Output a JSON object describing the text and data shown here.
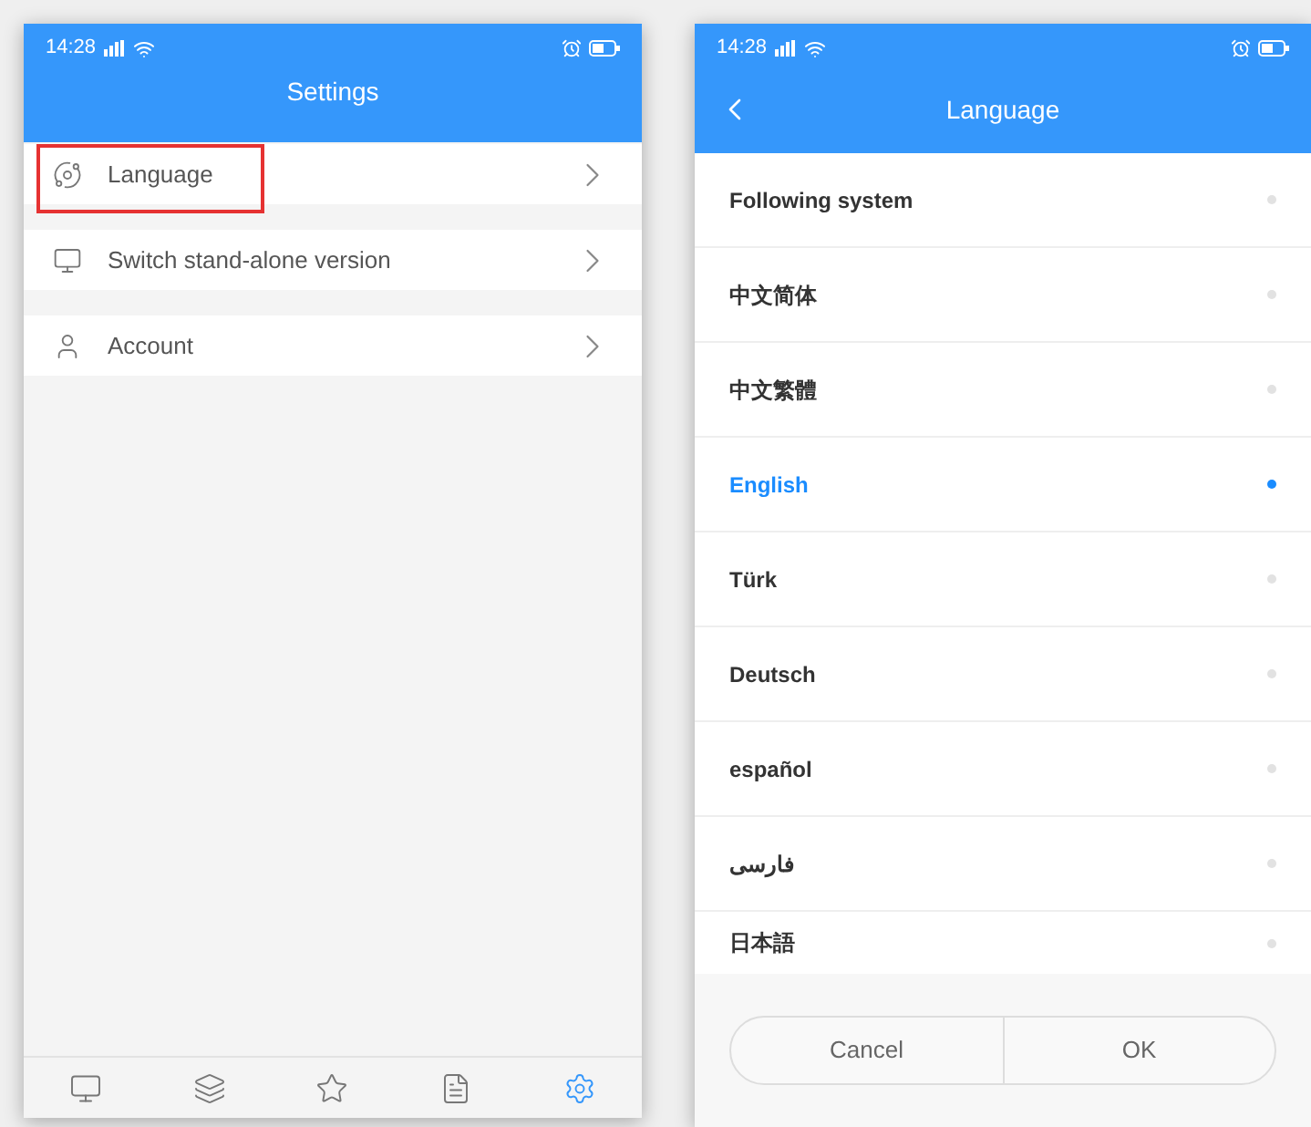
{
  "settings_screen": {
    "status_bar": {
      "time": "14:28"
    },
    "title": "Settings",
    "items": [
      {
        "label": "Language",
        "kind": "planet",
        "highlighted": true
      },
      {
        "label": "Switch stand-alone version",
        "kind": "monitor",
        "highlighted": false
      },
      {
        "label": "Account",
        "kind": "person",
        "highlighted": false
      }
    ],
    "nav_tabs": [
      {
        "kind": "monitor",
        "selected": false
      },
      {
        "kind": "layers",
        "selected": false
      },
      {
        "kind": "star",
        "selected": false
      },
      {
        "kind": "list",
        "selected": false
      },
      {
        "kind": "settings",
        "selected": true
      }
    ]
  },
  "language_screen": {
    "status_bar": {
      "time": "14:28"
    },
    "title": "Language",
    "options": [
      {
        "label": "Following system",
        "selected": false
      },
      {
        "label": "中文简体",
        "selected": false
      },
      {
        "label": "中文繁體",
        "selected": false
      },
      {
        "label": "English",
        "selected": true
      },
      {
        "label": "Türk",
        "selected": false
      },
      {
        "label": "Deutsch",
        "selected": false
      },
      {
        "label": "español",
        "selected": false
      },
      {
        "label": "فارسی",
        "selected": false
      },
      {
        "label": "日本語",
        "selected": false
      }
    ],
    "buttons": [
      "Cancel",
      "OK"
    ]
  }
}
